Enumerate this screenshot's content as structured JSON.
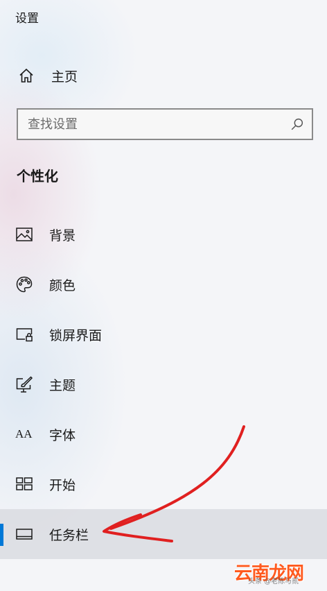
{
  "window": {
    "title": "设置"
  },
  "home": {
    "label": "主页"
  },
  "search": {
    "placeholder": "查找设置"
  },
  "section": {
    "title": "个性化"
  },
  "nav": [
    {
      "label": "背景",
      "icon": "image-icon"
    },
    {
      "label": "颜色",
      "icon": "palette-icon"
    },
    {
      "label": "锁屏界面",
      "icon": "lock-screen-icon"
    },
    {
      "label": "主题",
      "icon": "theme-brush-icon"
    },
    {
      "label": "字体",
      "icon": "font-icon"
    },
    {
      "label": "开始",
      "icon": "start-grid-icon"
    },
    {
      "label": "任务栏",
      "icon": "taskbar-icon",
      "selected": true
    }
  ],
  "font_icon_glyph": "AA",
  "colors": {
    "accent": "#0078d7",
    "annotation": "#e02020"
  },
  "watermark": {
    "logo": "云南龙网",
    "text": "头条 @老陈与贰"
  }
}
